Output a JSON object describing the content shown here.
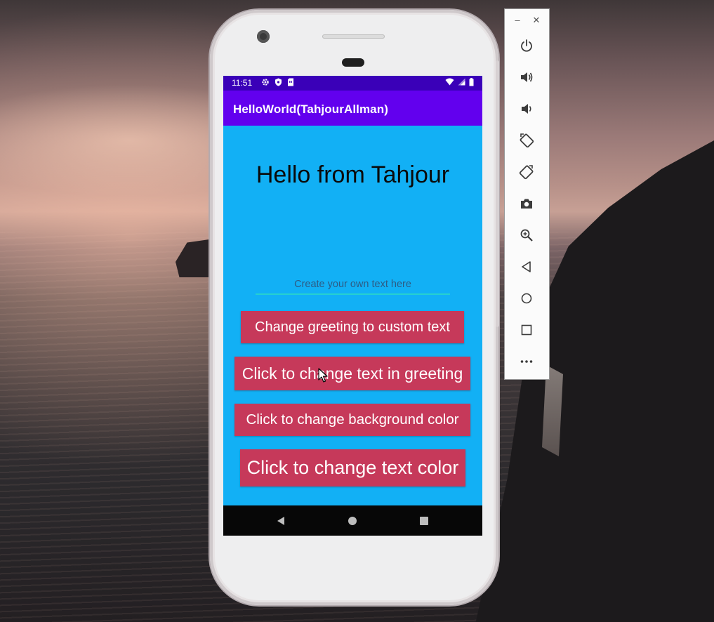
{
  "status_bar": {
    "time": "11:51",
    "left_icons": [
      "settings-icon",
      "shield-icon",
      "sim-card-icon"
    ],
    "right_icons": [
      "wifi-icon",
      "signal-icon",
      "battery-icon"
    ]
  },
  "app_bar": {
    "title": "HelloWorld(TahjourAllman)"
  },
  "main": {
    "greeting": "Hello from Tahjour",
    "input": {
      "value": "",
      "placeholder": "Create your own text here"
    },
    "buttons": {
      "custom_text": "Change greeting to custom text",
      "change_text": "Click to change text in greeting",
      "background_color": "Click to change background color",
      "text_color": "Click to change text color"
    }
  },
  "nav_bar": {
    "icons": [
      "back-icon",
      "home-icon",
      "recents-icon"
    ]
  },
  "emulator_toolbar": {
    "window_controls": {
      "minimize": "–",
      "close": "✕"
    },
    "buttons": [
      "power-icon",
      "volume-up-icon",
      "volume-down-icon",
      "rotate-left-icon",
      "rotate-right-icon",
      "camera-icon",
      "zoom-icon",
      "back-icon",
      "home-icon",
      "overview-icon",
      "more-icon"
    ]
  },
  "colors": {
    "status_bar": "#3a00b8",
    "app_bar": "#6200ee",
    "screen_background": "#12b0f5",
    "button": "#c6395a",
    "input_underline": "#26d0d0"
  }
}
